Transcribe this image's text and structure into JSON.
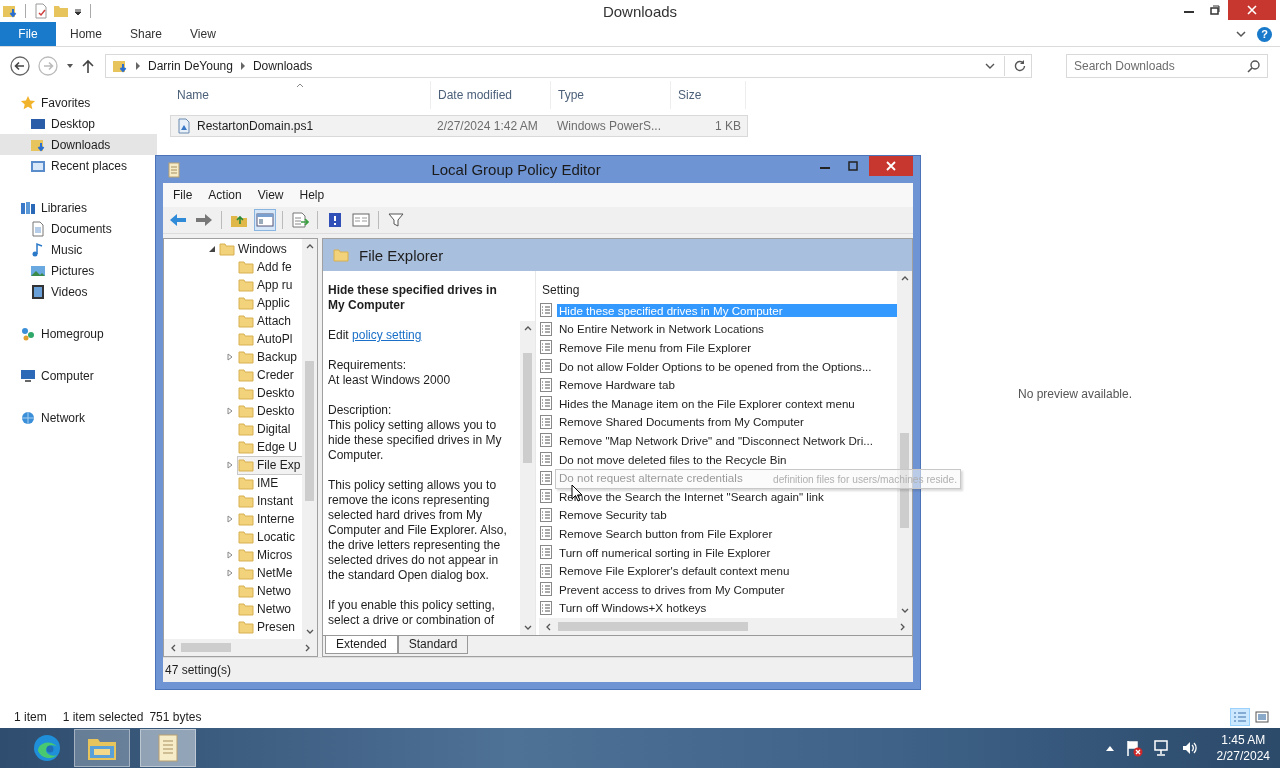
{
  "explorer": {
    "title": "Downloads",
    "ribbon_tabs": [
      {
        "label": "File",
        "kind": "file"
      },
      {
        "label": "Home",
        "kind": "tab"
      },
      {
        "label": "Share",
        "kind": "tab"
      },
      {
        "label": "View",
        "kind": "tab"
      }
    ],
    "help": "?",
    "address": {
      "path": [
        "Darrin DeYoung",
        "Downloads"
      ]
    },
    "search": {
      "placeholder": "Search Downloads"
    },
    "nav": [
      {
        "label": "Favorites",
        "selected": false,
        "children": [
          {
            "label": "Desktop",
            "selected": false
          },
          {
            "label": "Downloads",
            "selected": true
          },
          {
            "label": "Recent places",
            "selected": false
          }
        ]
      },
      {
        "label": "Libraries",
        "selected": false,
        "children": [
          {
            "label": "Documents",
            "selected": false
          },
          {
            "label": "Music",
            "selected": false
          },
          {
            "label": "Pictures",
            "selected": false
          },
          {
            "label": "Videos",
            "selected": false
          }
        ]
      },
      {
        "label": "Homegroup",
        "selected": false
      },
      {
        "label": "Computer",
        "selected": false
      },
      {
        "label": "Network",
        "selected": false
      }
    ],
    "columns": [
      "Name",
      "Date modified",
      "Type",
      "Size"
    ],
    "files": [
      {
        "name": "RestartonDomain.ps1",
        "date": "2/27/2024 1:42 AM",
        "type": "Windows PowerS...",
        "size": "1 KB",
        "selected": true
      }
    ],
    "preview": "No preview available.",
    "status": {
      "count": "1 item",
      "selection": "1 item selected",
      "bytes": "751 bytes"
    }
  },
  "dialog": {
    "title": "Local Group Policy Editor",
    "menu": [
      "File",
      "Action",
      "View",
      "Help"
    ],
    "toolbar": [
      {
        "pressed": false
      },
      {
        "pressed": false
      },
      {
        "pressed": false
      },
      {
        "pressed": true
      },
      {
        "pressed": false
      },
      {
        "pressed": false
      },
      {
        "pressed": false
      },
      {
        "pressed": false
      }
    ],
    "tree": [
      {
        "label": "Windows",
        "expanded": true,
        "children": [
          {
            "label": "Add fe",
            "expandable": false,
            "selected": false
          },
          {
            "label": "App ru",
            "expandable": false,
            "selected": false
          },
          {
            "label": "Applic",
            "expandable": false,
            "selected": false
          },
          {
            "label": "Attach",
            "expandable": false,
            "selected": false
          },
          {
            "label": "AutoPl",
            "expandable": false,
            "selected": false
          },
          {
            "label": "Backup",
            "expandable": true,
            "selected": false
          },
          {
            "label": "Creder",
            "expandable": false,
            "selected": false
          },
          {
            "label": "Deskto",
            "expandable": false,
            "selected": false
          },
          {
            "label": "Deskto",
            "expandable": true,
            "selected": false
          },
          {
            "label": "Digital",
            "expandable": false,
            "selected": false
          },
          {
            "label": "Edge U",
            "expandable": false,
            "selected": false
          },
          {
            "label": "File Exp",
            "expandable": true,
            "selected": true
          },
          {
            "label": "IME",
            "expandable": false,
            "selected": false
          },
          {
            "label": "Instant",
            "expandable": false,
            "selected": false
          },
          {
            "label": "Interne",
            "expandable": true,
            "selected": false
          },
          {
            "label": "Locatic",
            "expandable": false,
            "selected": false
          },
          {
            "label": "Micros",
            "expandable": true,
            "selected": false
          },
          {
            "label": "NetMe",
            "expandable": true,
            "selected": false
          },
          {
            "label": "Netwo",
            "expandable": false,
            "selected": false
          },
          {
            "label": "Netwo",
            "expandable": false,
            "selected": false
          },
          {
            "label": "Presen",
            "expandable": false,
            "selected": false
          }
        ]
      }
    ],
    "header": "File Explorer",
    "description": {
      "title": "Hide these specified drives in My Computer",
      "edit_prefix": "Edit",
      "edit_link": "policy setting",
      "requirements_label": "Requirements:",
      "requirements": "At least Windows 2000",
      "description_label": "Description:",
      "paragraphs": [
        "This policy setting allows you to hide these specified drives in My Computer.",
        "This policy setting allows you to remove the icons representing selected hard drives from My Computer and File Explorer. Also, the drive letters representing the selected drives do not appear in the standard Open dialog box.",
        "If you enable this policy setting, select a drive or combination of"
      ]
    },
    "settings_column": "Setting",
    "settings": [
      {
        "label": "Hide these specified drives in My Computer",
        "selected": true
      },
      {
        "label": "No Entire Network in Network Locations",
        "selected": false
      },
      {
        "label": "Remove File menu from File Explorer",
        "selected": false
      },
      {
        "label": "Do not allow Folder Options to be opened from the Options...",
        "selected": false
      },
      {
        "label": "Remove Hardware tab",
        "selected": false
      },
      {
        "label": "Hides the Manage item on the File Explorer context menu",
        "selected": false
      },
      {
        "label": "Remove Shared Documents from My Computer",
        "selected": false
      },
      {
        "label": "Remove \"Map Network Drive\" and \"Disconnect Network Dri...",
        "selected": false
      },
      {
        "label": "Do not move deleted files to the Recycle Bin",
        "selected": false
      },
      {
        "label": "Do not request alternate credentials",
        "selected": false
      },
      {
        "label": "Remove the Search the Internet \"Search again\" link",
        "selected": false
      },
      {
        "label": "Remove Security tab",
        "selected": false
      },
      {
        "label": "Remove Search button from File Explorer",
        "selected": false
      },
      {
        "label": "Turn off numerical sorting in File Explorer",
        "selected": false
      },
      {
        "label": "Remove File Explorer's default context menu",
        "selected": false
      },
      {
        "label": "Prevent access to drives from My Computer",
        "selected": false
      },
      {
        "label": "Turn off Windows+X hotkeys",
        "selected": false
      }
    ],
    "tooltip": "definition files for users/machines reside.",
    "tabs": [
      {
        "label": "Extended",
        "selected": true
      },
      {
        "label": "Standard",
        "selected": false
      }
    ],
    "status": "47 setting(s)"
  },
  "taskbar": {
    "apps": [
      {
        "selected": false
      },
      {
        "selected": false
      },
      {
        "selected": true
      }
    ],
    "time": "1:45 AM",
    "date": "2/27/2024"
  }
}
